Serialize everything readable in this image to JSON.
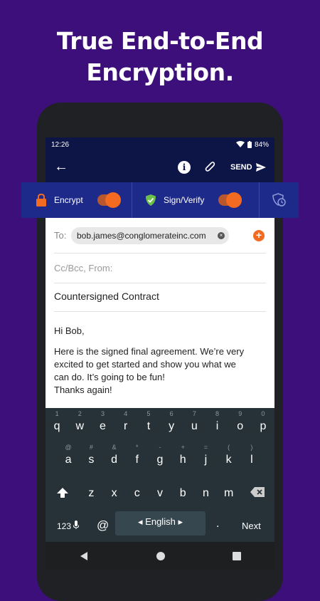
{
  "headline": [
    "True End-to-End",
    "Encryption."
  ],
  "status": {
    "time": "12:26",
    "battery": "84%"
  },
  "appbar": {
    "send_label": "SEND"
  },
  "options": {
    "encrypt_label": "Encrypt",
    "sign_label": "Sign/Verify",
    "encrypt_on": true,
    "sign_on": true
  },
  "compose": {
    "to_label": "To:",
    "recipient": "bob.james@conglomerateinc.com",
    "cc_placeholder": "Cc/Bcc, From:",
    "subject": "Countersigned Contract",
    "greeting": "Hi Bob,",
    "body_line1": "Here is the signed final agreement. We’re very",
    "body_line2": "excited to get started and show you what we",
    "body_line3": "can do. It’s going to be fun!",
    "body_line4": "Thanks again!"
  },
  "keyboard": {
    "row1": [
      "q",
      "w",
      "e",
      "r",
      "t",
      "y",
      "u",
      "i",
      "o",
      "p"
    ],
    "row1_hints": [
      "1",
      "2",
      "3",
      "4",
      "5",
      "6",
      "7",
      "8",
      "9",
      "0"
    ],
    "row2": [
      "a",
      "s",
      "d",
      "f",
      "g",
      "h",
      "j",
      "k",
      "l"
    ],
    "row2_hints": [
      "@",
      "#",
      "&",
      "*",
      "-",
      "+",
      "=",
      "(",
      ")"
    ],
    "row3": [
      "z",
      "x",
      "c",
      "v",
      "b",
      "n",
      "m"
    ],
    "symbols_label": "123",
    "at_key": "@",
    "language": "English",
    "period": ".",
    "next_label": "Next"
  },
  "colors": {
    "background": "#3d0f7a",
    "appbar": "#0d1446",
    "optbar": "#1e2a8a",
    "accent": "#f26b21"
  }
}
